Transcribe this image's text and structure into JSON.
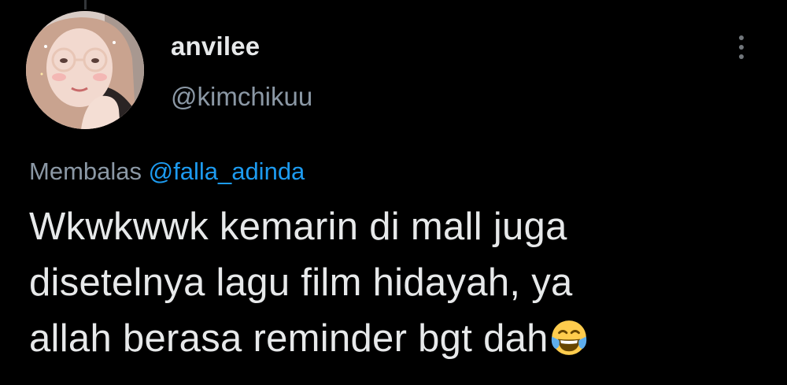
{
  "tweet": {
    "author": {
      "display_name": "anvilee",
      "handle": "@kimchikuu",
      "avatar_icon": "profile-avatar"
    },
    "more_icon": "more-vertical-icon",
    "reply_context": {
      "prefix": "Membalas",
      "mention": "@falla_adinda"
    },
    "text_line1": "Wkwkwwk kemarin di mall juga",
    "text_line2": "disetelnya lagu film hidayah, ya",
    "text_line3": "allah berasa reminder bgt dah",
    "emoji": "face-with-tears-of-joy-icon"
  },
  "colors": {
    "background": "#000000",
    "primary_text": "#e7e9ea",
    "secondary_text": "#8b98a5",
    "link": "#1d9bf0",
    "thread_line": "#333639"
  }
}
